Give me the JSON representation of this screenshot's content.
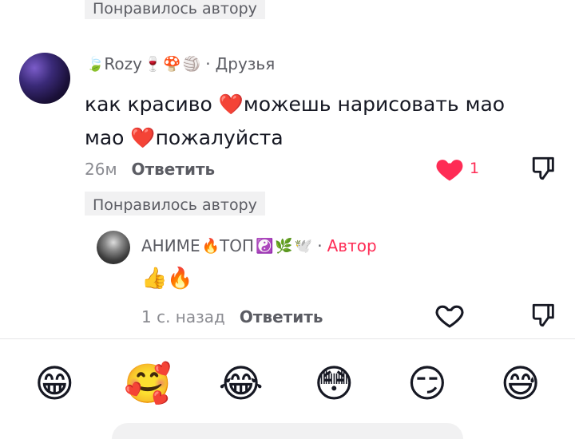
{
  "liked_by_author_label_top": "Понравилось автору",
  "comment": {
    "username": "Rozy",
    "username_prefix_emoji": "🍃",
    "username_suffix_emojis": [
      "🍷",
      "🍄",
      "🏐"
    ],
    "relation": "Друзья",
    "text_part1": "как красиво ",
    "heart1": "❤️",
    "text_part2": "можешь нарисовать мао мао ",
    "heart2": "❤️",
    "text_part3": "пожалуйста",
    "time": "26м",
    "reply_label": "Ответить",
    "likes": "1",
    "liked_by_author_label": "Понравилось автору"
  },
  "reply": {
    "username": "АНИМЕ",
    "name_emoji1": "🔥",
    "username_part2": "ТОП",
    "name_emojis_tail": [
      "☯️",
      "🌿",
      "🕊️"
    ],
    "author_tag": "Автор",
    "text": "👍🔥",
    "time": "1 с. назад",
    "reply_label": "Ответить"
  },
  "emoji_bar": [
    "😁",
    "🥰",
    "😂",
    "😳",
    "😏",
    "😅"
  ],
  "colors": {
    "accent": "#fe2c55",
    "heart": "#e0143c",
    "secondary_text": "#8a8b91",
    "badge_bg": "#f1f1f2"
  }
}
